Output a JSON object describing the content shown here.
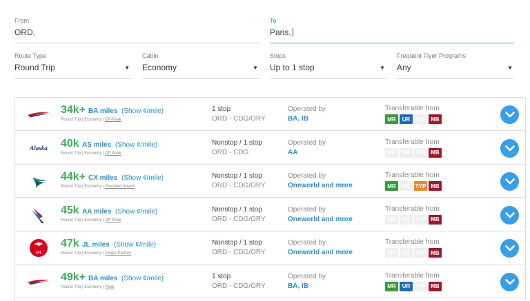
{
  "search": {
    "from": {
      "label": "From",
      "value": "ORD,"
    },
    "to": {
      "label": "To",
      "value": "Paris,"
    },
    "route_type": {
      "label": "Route Type",
      "value": "Round Trip"
    },
    "cabin": {
      "label": "Cabin",
      "value": "Economy"
    },
    "stops": {
      "label": "Stops",
      "value": "Up to 1 stop"
    },
    "ffp": {
      "label": "Frequent Flyer Programs",
      "value": "Any"
    }
  },
  "labels": {
    "show_link": "(Show ¢/mile)",
    "operated_by": "Operated by",
    "transferable_from": "Transferable from",
    "sub_prefix": "Round Trip | Economy | "
  },
  "badge_colors": {
    "MR": "#3b9a3e",
    "UR": "#1d6db3",
    "TYP": "#e8892a",
    "MB": "#9b1b2e"
  },
  "results": [
    {
      "logo": "british-airways-icon",
      "miles": "34k+",
      "program": "BA miles",
      "award": "Off-Peak",
      "stops": "1 stop",
      "route": "ORD - CDG/ORY",
      "operated": "BA, IB",
      "badges": [
        {
          "code": "MR",
          "on": true
        },
        {
          "code": "UR",
          "on": true
        },
        {
          "code": "TYP",
          "on": false
        },
        {
          "code": "MB",
          "on": true
        }
      ]
    },
    {
      "logo": "alaska-airlines-icon",
      "miles": "40k",
      "program": "AS miles",
      "award": "Off Peak",
      "stops": "Nonstop / 1 stop",
      "route": "ORD - CDG",
      "operated": "AA",
      "badges": [
        {
          "code": "MR",
          "on": false
        },
        {
          "code": "UR",
          "on": false
        },
        {
          "code": "TYP",
          "on": false
        },
        {
          "code": "MB",
          "on": true
        }
      ]
    },
    {
      "logo": "cathay-pacific-icon",
      "miles": "44k+",
      "program": "CX miles",
      "award": "Standard Award",
      "stops": "Nonstop / 1 stop",
      "route": "ORD - CDG/ORY",
      "operated": "Oneworld and more",
      "badges": [
        {
          "code": "MR",
          "on": true
        },
        {
          "code": "UR",
          "on": false
        },
        {
          "code": "TYP",
          "on": true
        },
        {
          "code": "MB",
          "on": true
        }
      ]
    },
    {
      "logo": "american-airlines-icon",
      "miles": "45k",
      "program": "AA miles",
      "award": "Off Peak",
      "stops": "Nonstop / 1 stop",
      "route": "ORD - CDG/ORY",
      "operated": "Oneworld and more",
      "badges": [
        {
          "code": "MR",
          "on": false
        },
        {
          "code": "UR",
          "on": false
        },
        {
          "code": "TYP",
          "on": false
        },
        {
          "code": "MB",
          "on": true
        }
      ]
    },
    {
      "logo": "japan-airlines-icon",
      "miles": "47k",
      "program": "JL miles",
      "award": "Single Partner",
      "stops": "Nonstop / 1 stop",
      "route": "ORD - CDG/ORY",
      "operated": "Oneworld and more",
      "badges": [
        {
          "code": "MR",
          "on": false
        },
        {
          "code": "UR",
          "on": false
        },
        {
          "code": "TYP",
          "on": false
        },
        {
          "code": "MB",
          "on": true
        }
      ]
    },
    {
      "logo": "british-airways-icon",
      "miles": "49k+",
      "program": "BA miles",
      "award": "Peak",
      "stops": "1 stop",
      "route": "ORD - CDG/ORY",
      "operated": "BA, IB",
      "badges": [
        {
          "code": "MR",
          "on": true
        },
        {
          "code": "UR",
          "on": true
        },
        {
          "code": "TYP",
          "on": false
        },
        {
          "code": "MB",
          "on": true
        }
      ]
    }
  ]
}
